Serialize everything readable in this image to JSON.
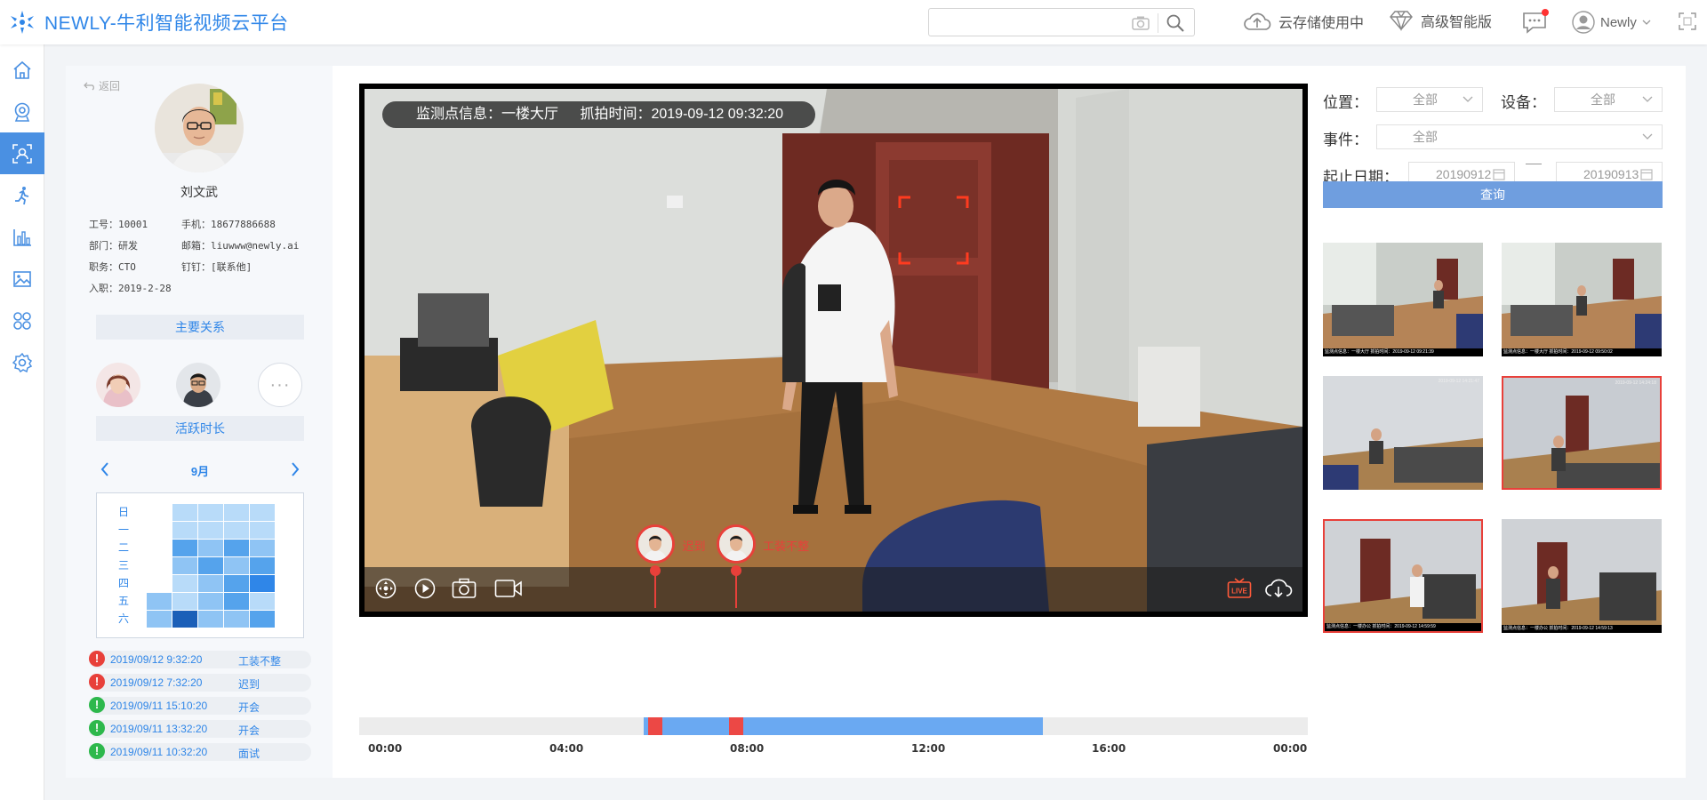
{
  "app": {
    "title": "NEWLY-牛利智能视频云平台"
  },
  "search": {
    "value": "",
    "placeholder": ""
  },
  "topbar": {
    "cloud_storage": "云存储使用中",
    "premium": "高级智能版",
    "user_name": "Newly"
  },
  "nav": {
    "items": [
      "home-icon",
      "camera-icon",
      "face-recognition-icon",
      "activity-icon",
      "stats-icon",
      "gallery-icon",
      "apps-icon",
      "settings-icon"
    ],
    "active_index": 2
  },
  "profile": {
    "back": "返回",
    "name": "刘文武",
    "fields": [
      {
        "label": "工号：",
        "value": "10001"
      },
      {
        "label": "手机：",
        "value": "18677886688"
      },
      {
        "label": "部门：",
        "value": "研发"
      },
      {
        "label": "邮箱：",
        "value": "liuwww@newly.ai"
      },
      {
        "label": "职务：",
        "value": "CTO"
      },
      {
        "label": "钉钉：",
        "value": "[联系他]"
      },
      {
        "label": "入职：",
        "value": "2019-2-28"
      }
    ],
    "relations_title": "主要关系",
    "more": "···",
    "activity_title": "活跃时长",
    "month": "9月",
    "weekdays": [
      "日",
      "一",
      "二",
      "三",
      "四",
      "五",
      "六"
    ]
  },
  "events": [
    {
      "time": "2019/09/12 9:32:20",
      "type": "工装不整",
      "status": "alert"
    },
    {
      "time": "2019/09/12 7:32:20",
      "type": "迟到",
      "status": "alert"
    },
    {
      "time": "2019/09/11 15:10:20",
      "type": "开会",
      "status": "normal"
    },
    {
      "time": "2019/09/11 13:32:20",
      "type": "开会",
      "status": "normal"
    },
    {
      "time": "2019/09/11 10:32:20",
      "type": "面试",
      "status": "normal"
    }
  ],
  "video": {
    "location_label": "监测点信息：一楼大厅",
    "capture_label": "抓拍时间：2019-09-12 09:32:20",
    "live_badge": "LIVE"
  },
  "timeline": {
    "markers": [
      {
        "label": "迟到",
        "time_hours": 7.5
      },
      {
        "label": "工装不整",
        "time_hours": 9.54
      }
    ],
    "active_range_hours": [
      7.2,
      17.3
    ],
    "ticks": [
      "00:00",
      "04:00",
      "08:00",
      "12:00",
      "16:00",
      "00:00"
    ]
  },
  "filters": {
    "location_label": "位置：",
    "location_value": "全部",
    "device_label": "设备：",
    "device_value": "全部",
    "event_label": "事件：",
    "event_value": "全部",
    "date_label": "起止日期：",
    "date_start": "20190912",
    "date_end": "20190913",
    "query_button": "查询"
  },
  "thumbnails": [
    {
      "caption": "监测点信息：一楼大厅  抓拍时间：2019-09-12 09:21:39",
      "selected": false
    },
    {
      "caption": "监测点信息：一楼大厅  抓拍时间：2019-09-12 09:50:02",
      "selected": false
    },
    {
      "caption": "2019-09-12 14:21:47",
      "selected": false
    },
    {
      "caption": "2019-09-12 14:24:18",
      "selected": true
    },
    {
      "caption": "监测点信息：一楼办公  抓拍时间：2019-09-12 14:59:59",
      "selected": true
    },
    {
      "caption": "监测点信息：一楼办公  抓拍时间：2019-09-12 14:59:13",
      "selected": false
    }
  ],
  "colors": {
    "brand": "#2f86e8",
    "alert": "#e8403a",
    "ok": "#2db84c",
    "timeline_fill": "#6aa9f2"
  }
}
